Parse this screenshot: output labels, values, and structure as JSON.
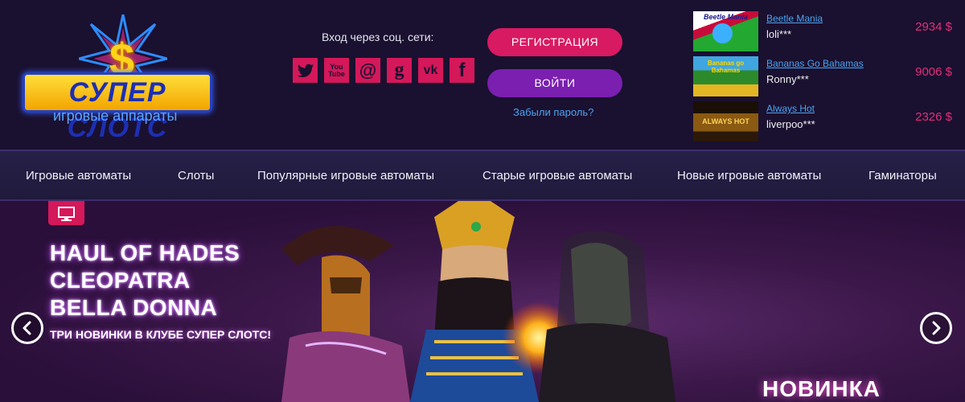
{
  "logo": {
    "title": "СУПЕР СЛОТС",
    "dollar": "$",
    "subtitle": "игровые аппараты"
  },
  "social": {
    "label": "Вход через соц. сети:",
    "items": [
      {
        "name": "twitter",
        "glyph": ""
      },
      {
        "name": "youtube",
        "glyph": "You Tube"
      },
      {
        "name": "mail",
        "glyph": "@"
      },
      {
        "name": "google",
        "glyph": "g"
      },
      {
        "name": "vk",
        "glyph": "vk"
      },
      {
        "name": "facebook",
        "glyph": "f"
      }
    ]
  },
  "auth": {
    "register_label": "РЕГИСТРАЦИЯ",
    "login_label": "ВОЙТИ",
    "forgot_label": "Забыли пароль?"
  },
  "winners": [
    {
      "game": "Beetle Mania",
      "user": "loli***",
      "amount": "2934 $",
      "thumb_text": "Beetle Mania"
    },
    {
      "game": "Bananas Go Bahamas",
      "user": "Ronny***",
      "amount": "9006 $",
      "thumb_text": "Bananas go Bahamas"
    },
    {
      "game": "Always Hot",
      "user": "liverpoo***",
      "amount": "2326 $",
      "thumb_text": "ALWAYS HOT"
    }
  ],
  "nav": [
    "Игровые автоматы",
    "Слоты",
    "Популярные игровые автоматы",
    "Старые игровые автоматы",
    "Новые игровые автоматы",
    "Гаминаторы"
  ],
  "banner": {
    "lines": [
      "HAUL OF HADES",
      "CLEOPATRA",
      "BELLA DONNA"
    ],
    "subtitle": "ТРИ НОВИНКИ В КЛУБЕ СУПЕР СЛОТС!",
    "badge": "НОВИНКА"
  },
  "colors": {
    "accent_pink": "#d81a62",
    "accent_purple": "#7a1fb0",
    "link_blue": "#4aa4f0",
    "amount_pink": "#e22f7a"
  }
}
